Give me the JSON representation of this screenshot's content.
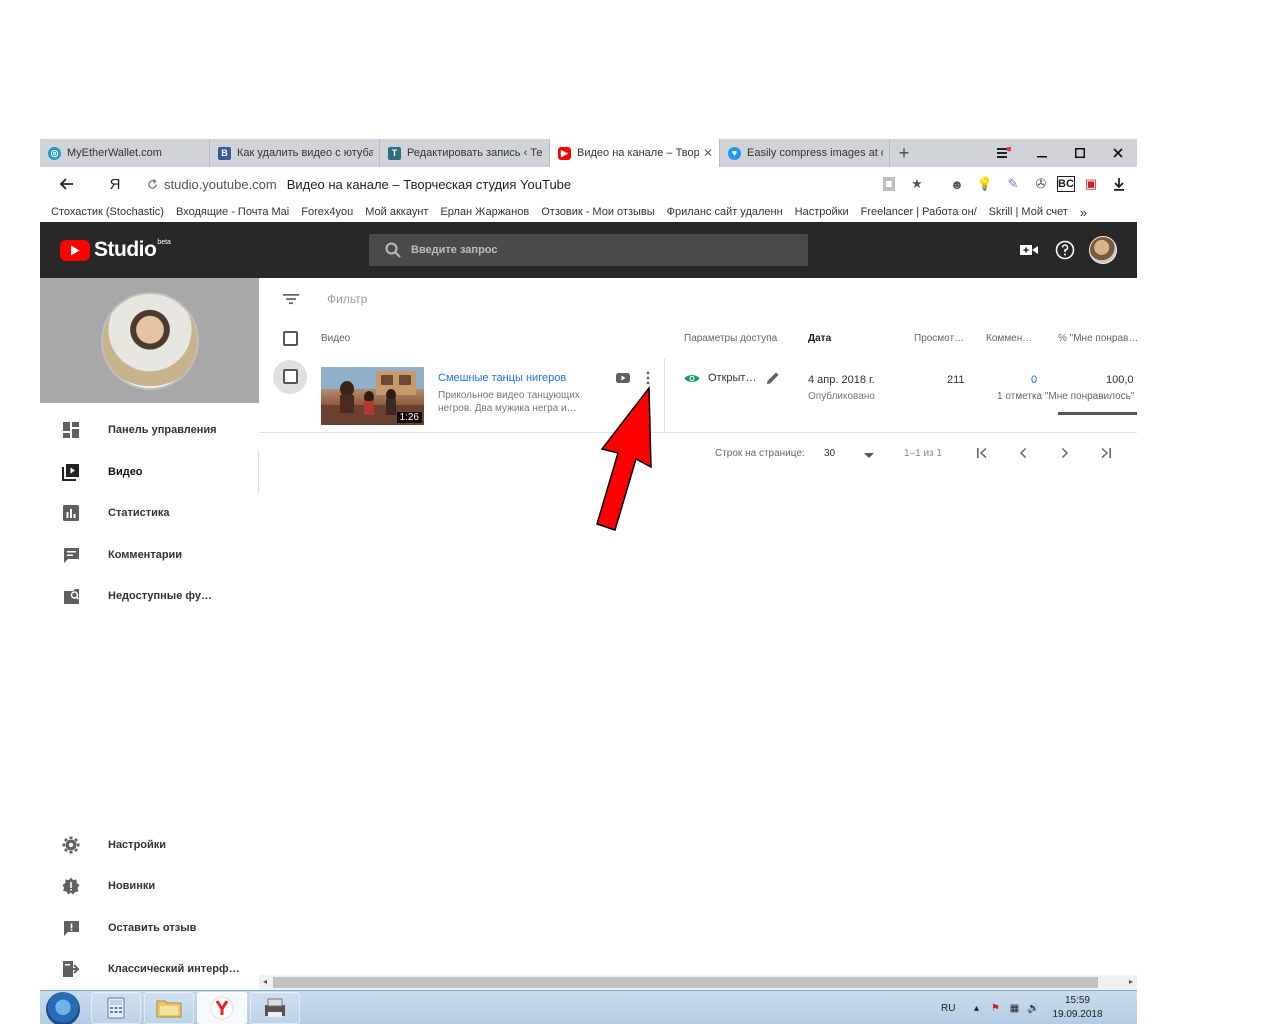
{
  "browser": {
    "tabs": [
      {
        "title": "MyEtherWallet.com",
        "favicon": "mew-logo-icon",
        "color": "#1e9ec4"
      },
      {
        "title": "Как удалить видео с ютуба",
        "favicon": "b-logo-icon",
        "color": "#3b5998"
      },
      {
        "title": "Редактировать запись ‹ Тег",
        "favicon": "wp-logo-icon",
        "color": "#2d6e7e"
      },
      {
        "title": "Видео на канале – Твор",
        "favicon": "youtube-logo-icon",
        "color": "#ff0000",
        "active": true
      },
      {
        "title": "Easily compress images at o",
        "favicon": "bird-logo-icon",
        "color": "#2196f3"
      }
    ],
    "new_tab_label": "+",
    "url_host": "studio.youtube.com",
    "page_title": "Видео на канале – Творческая студия YouTube",
    "yandex_label": "Я",
    "bookmarks": [
      "Стохастик (Stochastic)",
      "Входящие - Почта Mai",
      "Forex4you",
      "Мой аккаунт",
      "Ерлан Жаржанов",
      "Отзовик - Мои отзывы",
      "Фриланс сайт удаленн",
      "Настройки",
      "Freelancer | Работа он/",
      "Skrill | Мой счет"
    ],
    "bookmarks_more": "»"
  },
  "studio": {
    "logo_word": "Studio",
    "beta": "beta",
    "search_placeholder": "Введите запрос",
    "sidebar": {
      "items": [
        {
          "label": "Панель управления",
          "icon": "dashboard-icon"
        },
        {
          "label": "Видео",
          "icon": "videos-icon",
          "active": true
        },
        {
          "label": "Статистика",
          "icon": "analytics-icon"
        },
        {
          "label": "Комментарии",
          "icon": "comments-icon"
        },
        {
          "label": "Недоступные фу…",
          "icon": "unavailable-features-icon"
        }
      ],
      "bottom_items": [
        {
          "label": "Настройки",
          "icon": "settings-icon"
        },
        {
          "label": "Новинки",
          "icon": "whats-new-icon"
        },
        {
          "label": "Оставить отзыв",
          "icon": "feedback-icon"
        },
        {
          "label": "Классический интерф…",
          "icon": "classic-studio-icon"
        }
      ]
    },
    "filter_placeholder": "Фильтр",
    "columns": {
      "video": "Видео",
      "visibility": "Параметры доступа",
      "date": "Дата",
      "views": "Просмот…",
      "comments": "Коммен…",
      "likes": "% \"Мне понрав…"
    },
    "video": {
      "title": "Смешные танцы нигеров",
      "description": "Прикольное видео танцующих негров. Два мужика негра и…",
      "duration": "1:26",
      "visibility": "Открыт…",
      "date": "4 апр. 2018 г.",
      "date_status": "Опубликовано",
      "views": "211",
      "comments": "0",
      "likes_pct": "100,0",
      "likes_note": "1 отметка \"Мне понравилось\""
    },
    "pager": {
      "rows_label": "Строк на странице:",
      "rows_value": "30",
      "range": "1–1 из 1"
    }
  },
  "taskbar": {
    "lang": "RU",
    "time": "15:59",
    "date": "19.09.2018"
  }
}
